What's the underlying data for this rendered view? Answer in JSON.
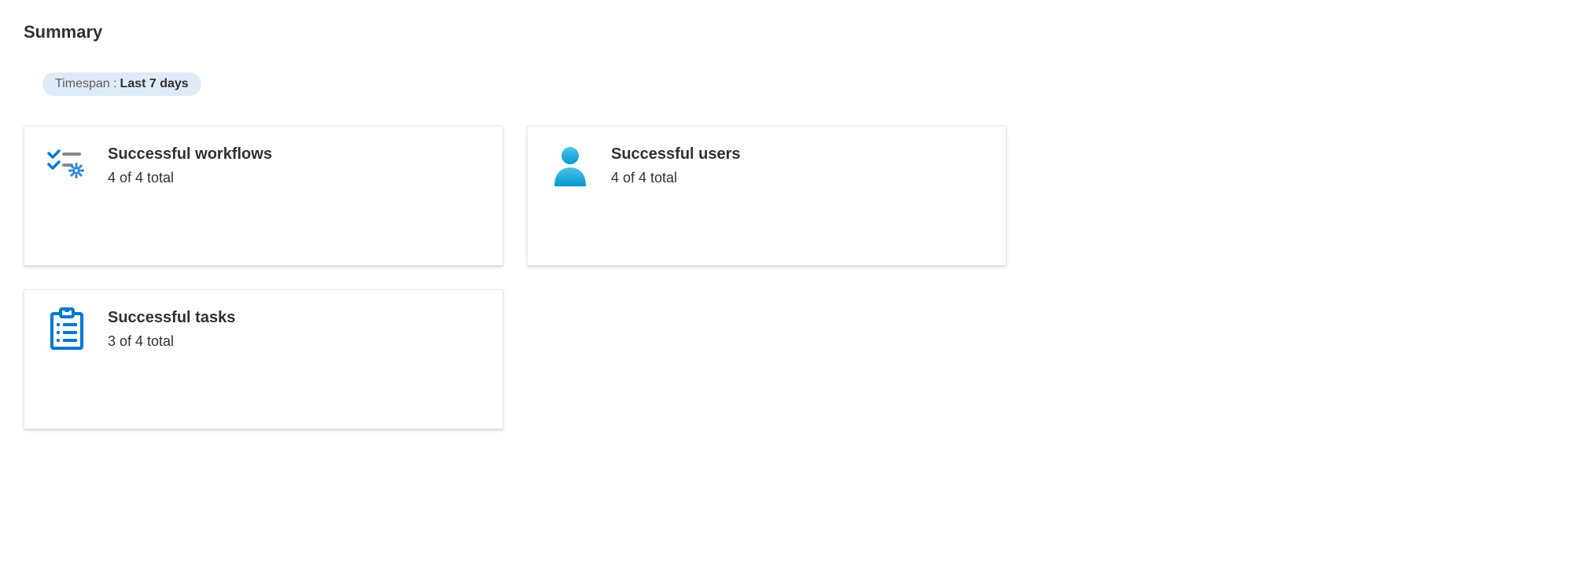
{
  "page": {
    "title": "Summary"
  },
  "timespan": {
    "label": "Timespan :",
    "value": "Last 7 days"
  },
  "cards": [
    {
      "id": "workflows",
      "title": "Successful workflows",
      "subtitle": "4 of 4 total"
    },
    {
      "id": "users",
      "title": "Successful users",
      "subtitle": "4 of 4 total"
    },
    {
      "id": "tasks",
      "title": "Successful tasks",
      "subtitle": "3 of 4 total"
    }
  ]
}
